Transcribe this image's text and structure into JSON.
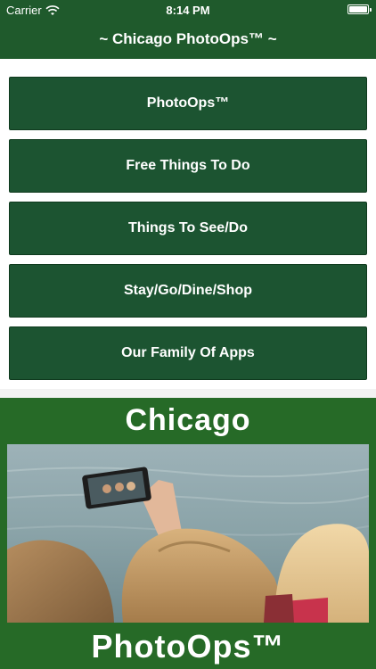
{
  "status_bar": {
    "carrier": "Carrier",
    "time": "8:14 PM",
    "icons": [
      "wifi-icon",
      "battery-icon"
    ]
  },
  "nav": {
    "title": "~ Chicago PhotoOps™ ~"
  },
  "menu": {
    "items": [
      {
        "label": "PhotoOps™"
      },
      {
        "label": "Free Things To Do"
      },
      {
        "label": "Things To See/Do"
      },
      {
        "label": "Stay/Go/Dine/Shop"
      },
      {
        "label": "Our Family Of Apps"
      }
    ]
  },
  "banner": {
    "top_text": "Chicago",
    "bottom_text": "PhotoOps™",
    "photo": "three women taking a selfie with a smartphone by the water"
  },
  "colors": {
    "nav_green": "#1f5a2c",
    "button_green": "#1c5431",
    "banner_green": "#266a27"
  }
}
